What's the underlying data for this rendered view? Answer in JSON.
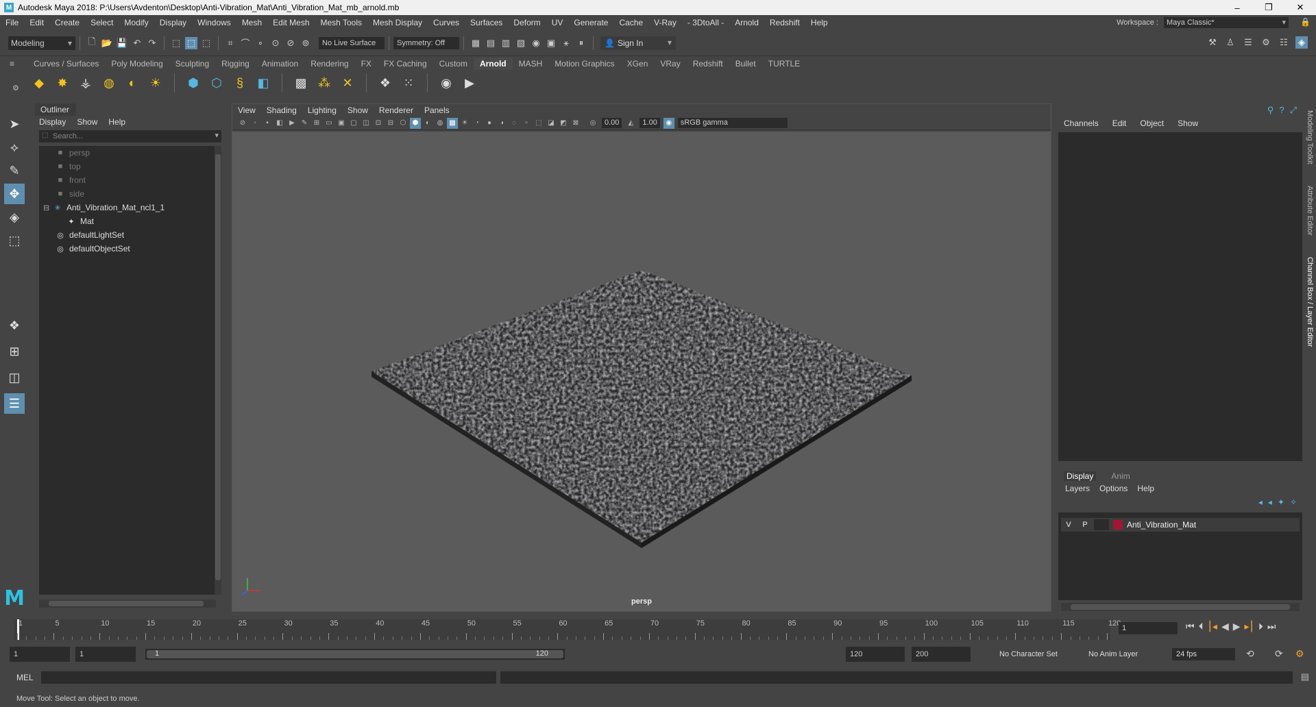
{
  "window": {
    "title": "Autodesk Maya 2018: P:\\Users\\Avdenton\\Desktop\\Anti-Vibration_Mat\\Anti_Vibration_Mat_mb_arnold.mb",
    "minimize": "–",
    "maximize": "❐",
    "close": "✕"
  },
  "menubar": {
    "items": [
      "File",
      "Edit",
      "Create",
      "Select",
      "Modify",
      "Display",
      "Windows",
      "Mesh",
      "Edit Mesh",
      "Mesh Tools",
      "Mesh Display",
      "Curves",
      "Surfaces",
      "Deform",
      "UV",
      "Generate",
      "Cache",
      "V-Ray",
      "- 3DtoAll -",
      "Arnold",
      "Redshift",
      "Help"
    ],
    "workspace_label": "Workspace :",
    "workspace_value": "Maya Classic*"
  },
  "statusline": {
    "mode": "Modeling",
    "live_surface": "No Live Surface",
    "symmetry": "Symmetry: Off",
    "sign_in": "Sign In"
  },
  "shelf": {
    "tabs": [
      "Curves / Surfaces",
      "Poly Modeling",
      "Sculpting",
      "Rigging",
      "Animation",
      "Rendering",
      "FX",
      "FX Caching",
      "Custom",
      "Arnold",
      "MASH",
      "Motion Graphics",
      "XGen",
      "VRay",
      "Redshift",
      "Bullet",
      "TURTLE"
    ],
    "active_tab": "Arnold"
  },
  "outliner": {
    "title": "Outliner",
    "menu": [
      "Display",
      "Show",
      "Help"
    ],
    "search_placeholder": "Search...",
    "items": [
      {
        "label": "persp",
        "kind": "camera",
        "dim": true
      },
      {
        "label": "top",
        "kind": "camera",
        "dim": true
      },
      {
        "label": "front",
        "kind": "camera",
        "dim": true
      },
      {
        "label": "side",
        "kind": "camera",
        "dim": true
      },
      {
        "label": "Anti_Vibration_Mat_ncl1_1",
        "kind": "group",
        "dim": false
      },
      {
        "label": "Mat",
        "kind": "mesh",
        "dim": false
      },
      {
        "label": "defaultLightSet",
        "kind": "set",
        "dim": false
      },
      {
        "label": "defaultObjectSet",
        "kind": "set",
        "dim": false
      }
    ]
  },
  "viewport": {
    "menu": [
      "View",
      "Shading",
      "Lighting",
      "Show",
      "Renderer",
      "Panels"
    ],
    "exposure": "0.00",
    "gamma": "1.00",
    "colorspace": "sRGB gamma",
    "camera": "persp"
  },
  "channelbox": {
    "menu": [
      "Channels",
      "Edit",
      "Object",
      "Show"
    ]
  },
  "side_tabs": [
    "Modeling Toolkit",
    "Attribute Editor",
    "Channel Box / Layer Editor"
  ],
  "layer_editor": {
    "tabs": [
      "Display",
      "Anim"
    ],
    "active_tab": "Display",
    "menu": [
      "Layers",
      "Options",
      "Help"
    ],
    "layers": [
      {
        "v": "V",
        "p": "P",
        "name": "Anti_Vibration_Mat",
        "color": "#a01830"
      }
    ]
  },
  "timeline": {
    "start": 1,
    "end": 120,
    "labels": [
      "1",
      "5",
      "10",
      "15",
      "20",
      "25",
      "30",
      "35",
      "40",
      "45",
      "50",
      "55",
      "60",
      "65",
      "70",
      "75",
      "80",
      "85",
      "90",
      "95",
      "100",
      "105",
      "110",
      "115",
      "120"
    ],
    "current_frame": "1"
  },
  "range": {
    "start_field": "1",
    "start2_field": "1",
    "bar_start": "1",
    "bar_end": "120",
    "end_field": "120",
    "end2_field": "200",
    "character_set": "No Character Set",
    "anim_layer": "No Anim Layer",
    "fps": "24 fps"
  },
  "cmdline": {
    "label": "MEL"
  },
  "helpline": {
    "text": "Move Tool: Select an object to move."
  },
  "colors": {
    "accent": "#5f8faf",
    "maya_logo": "#2ec1e0",
    "layer_color": "#a01830"
  }
}
